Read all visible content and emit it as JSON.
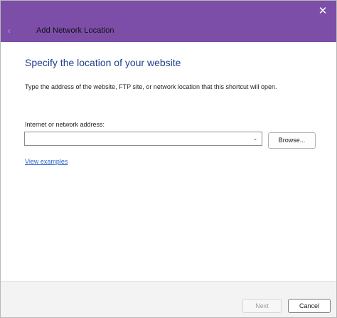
{
  "window": {
    "title": "Add Network Location",
    "close_glyph": "✕",
    "back_glyph": "‹",
    "accent_color": "#7c4ea8"
  },
  "main": {
    "heading": "Specify the location of your website",
    "instruction": "Type the address of the website, FTP site, or network location that this shortcut will open.",
    "address_label": "Internet or network address:",
    "address_value": "",
    "dropdown_glyph": "⌄",
    "browse_label": "Browse...",
    "examples_link": "View examples"
  },
  "footer": {
    "next_label": "Next",
    "cancel_label": "Cancel"
  },
  "icons": {
    "close": "close-icon",
    "back": "back-arrow-icon",
    "dropdown": "chevron-down-icon"
  }
}
